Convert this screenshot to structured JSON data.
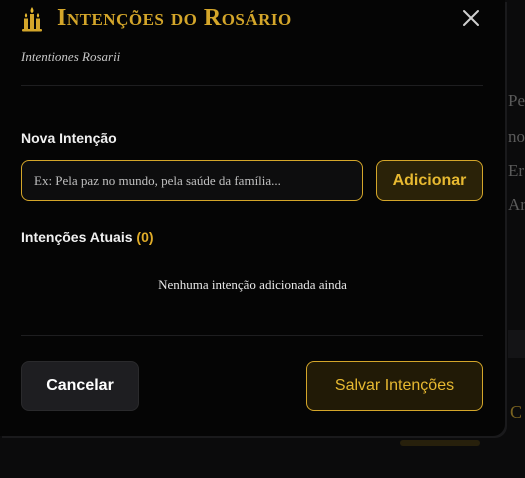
{
  "background": {
    "fragments": [
      "Pe",
      "no",
      "Er",
      "Ar"
    ],
    "gold_fragment": "C"
  },
  "modal": {
    "title": "Intenções do Rosário",
    "subtitle": "Intentiones Rosarii",
    "title_icon": "candles-icon",
    "close_icon": "close-icon",
    "new_label": "Nova Intenção",
    "input_value": "",
    "input_placeholder": "Ex: Pela paz no mundo, pela saúde da família...",
    "add_label": "Adicionar",
    "current_label": "Intenções Atuais",
    "current_count": "(0)",
    "empty_message": "Nenhuma intenção adicionada ainda",
    "cancel_label": "Cancelar",
    "save_label": "Salvar Intenções"
  },
  "colors": {
    "accent": "#d4a62a",
    "background": "#050505",
    "text": "#f0f0f0"
  }
}
